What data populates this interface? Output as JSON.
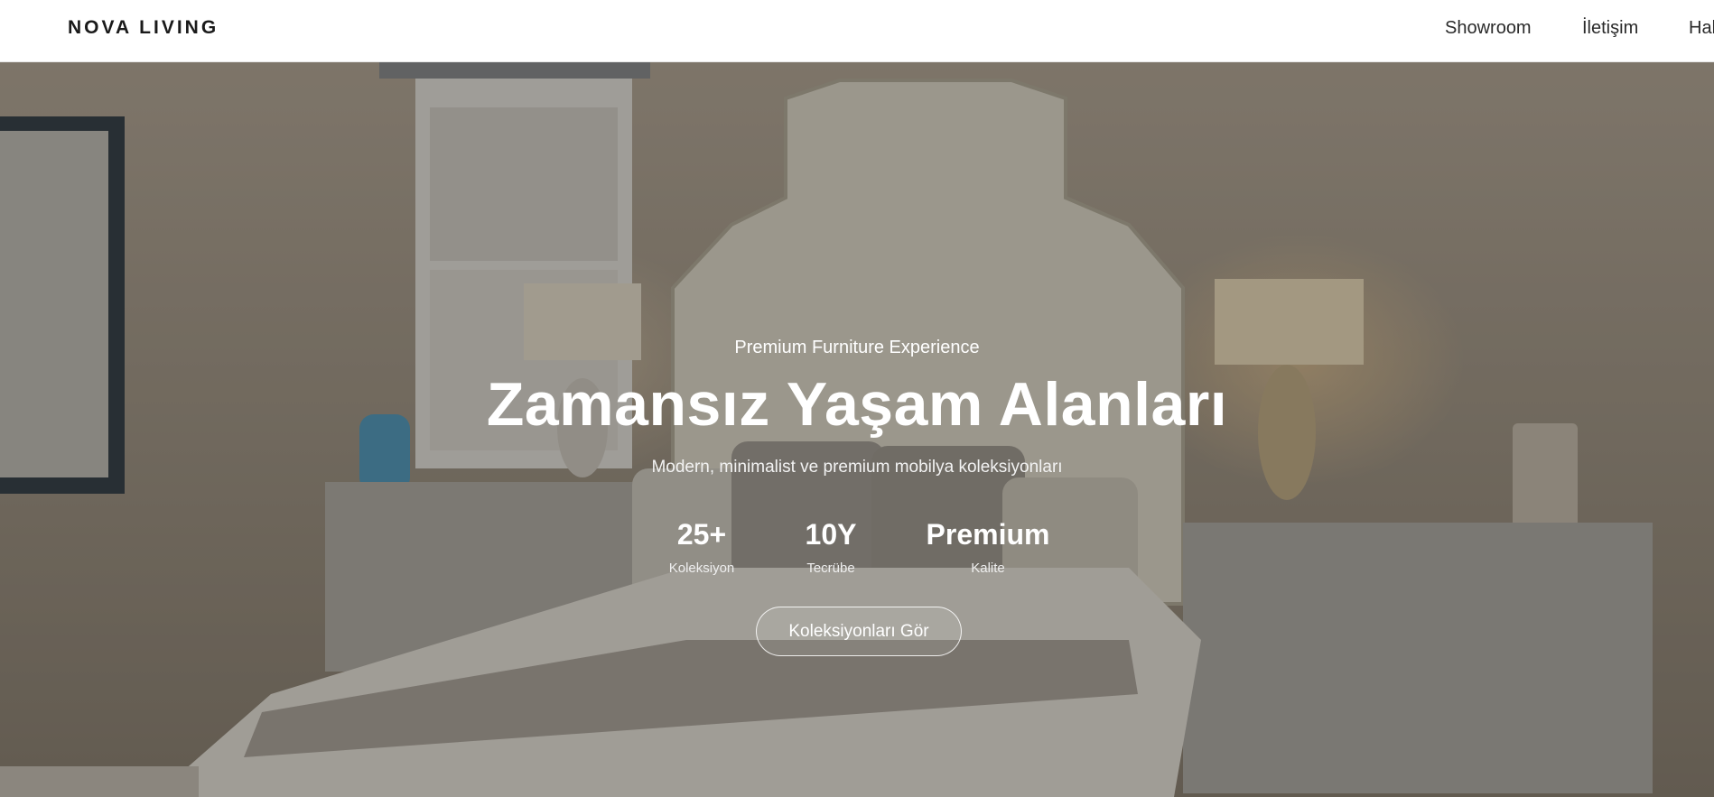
{
  "nav": {
    "logo": "NOVA LIVING",
    "links": [
      {
        "label": "Showroom"
      },
      {
        "label": "İletişim"
      },
      {
        "label": "Hak"
      }
    ]
  },
  "hero": {
    "eyebrow": "Premium Furniture Experience",
    "title": "Zamansız Yaşam Alanları",
    "subtitle": "Modern, minimalist ve premium mobilya koleksiyonları",
    "stats": [
      {
        "value": "25+",
        "label": "Koleksiyon"
      },
      {
        "value": "10Y",
        "label": "Tecrübe"
      },
      {
        "value": "Premium",
        "label": "Kalite"
      }
    ],
    "cta_label": "Koleksiyonları Gör"
  }
}
